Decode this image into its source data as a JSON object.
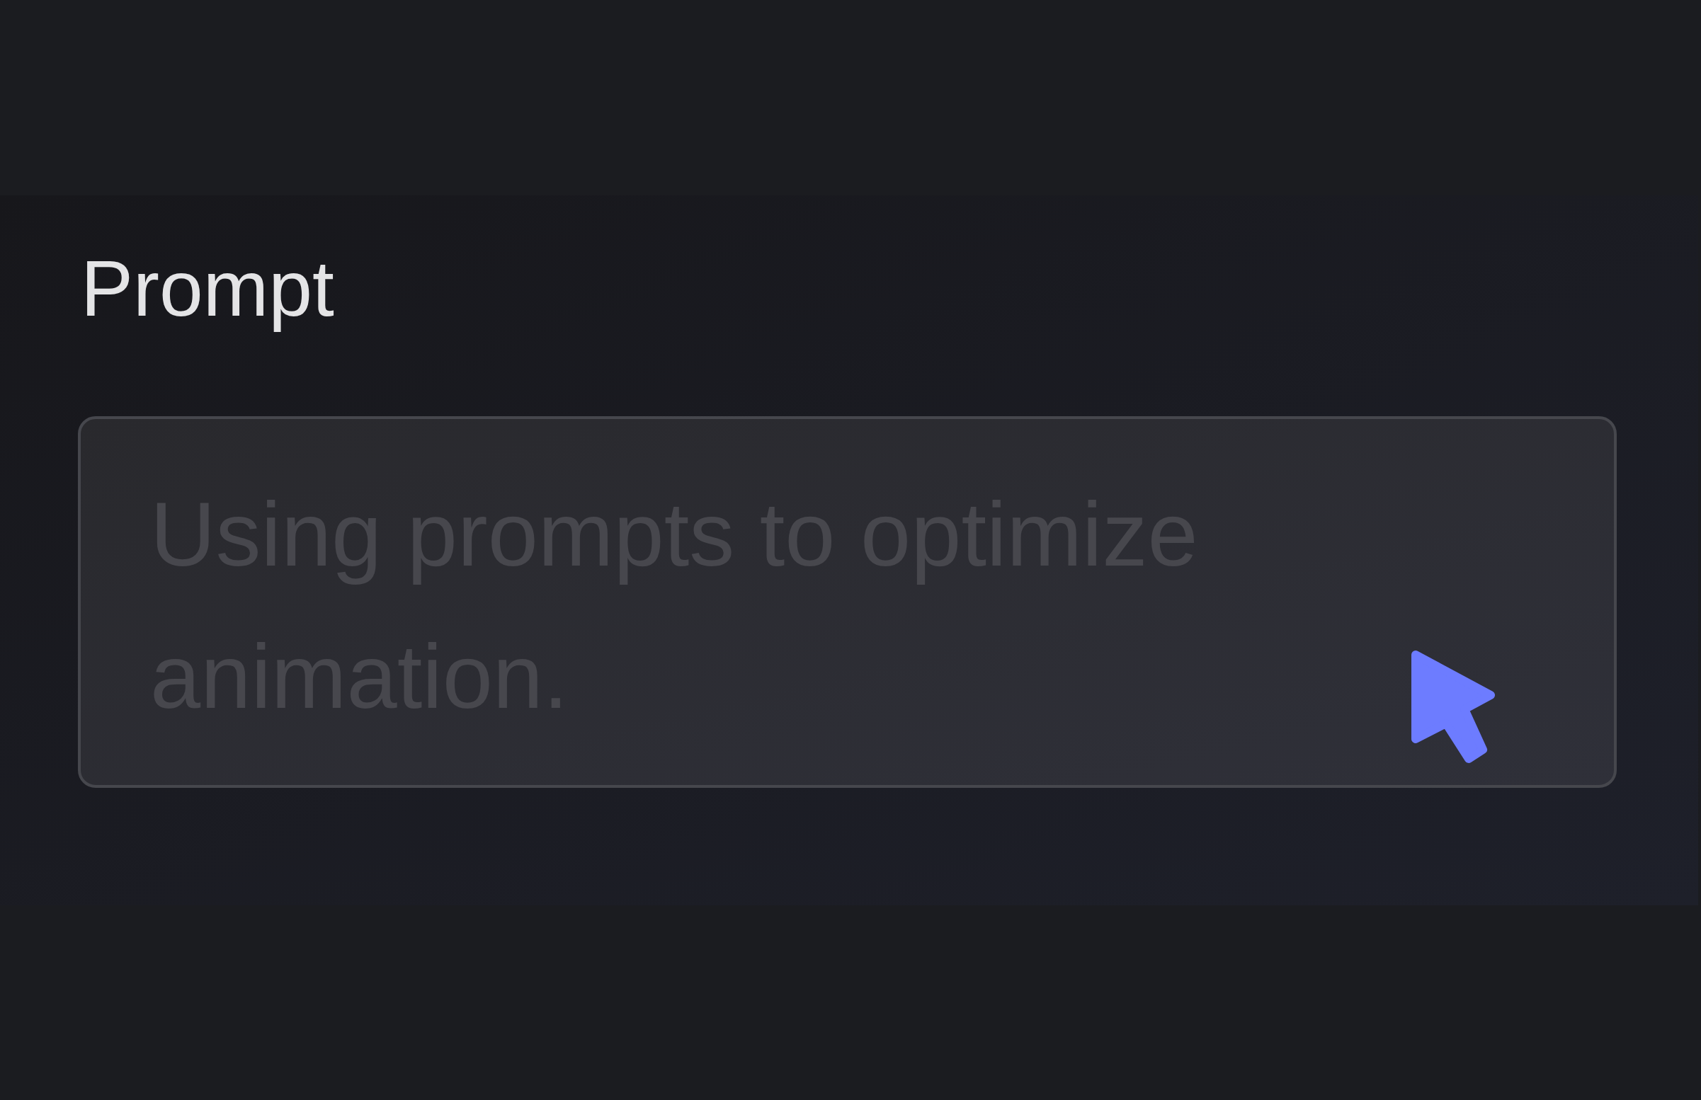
{
  "prompt": {
    "label": "Prompt",
    "placeholder": "Using prompts to optimize animation."
  }
}
